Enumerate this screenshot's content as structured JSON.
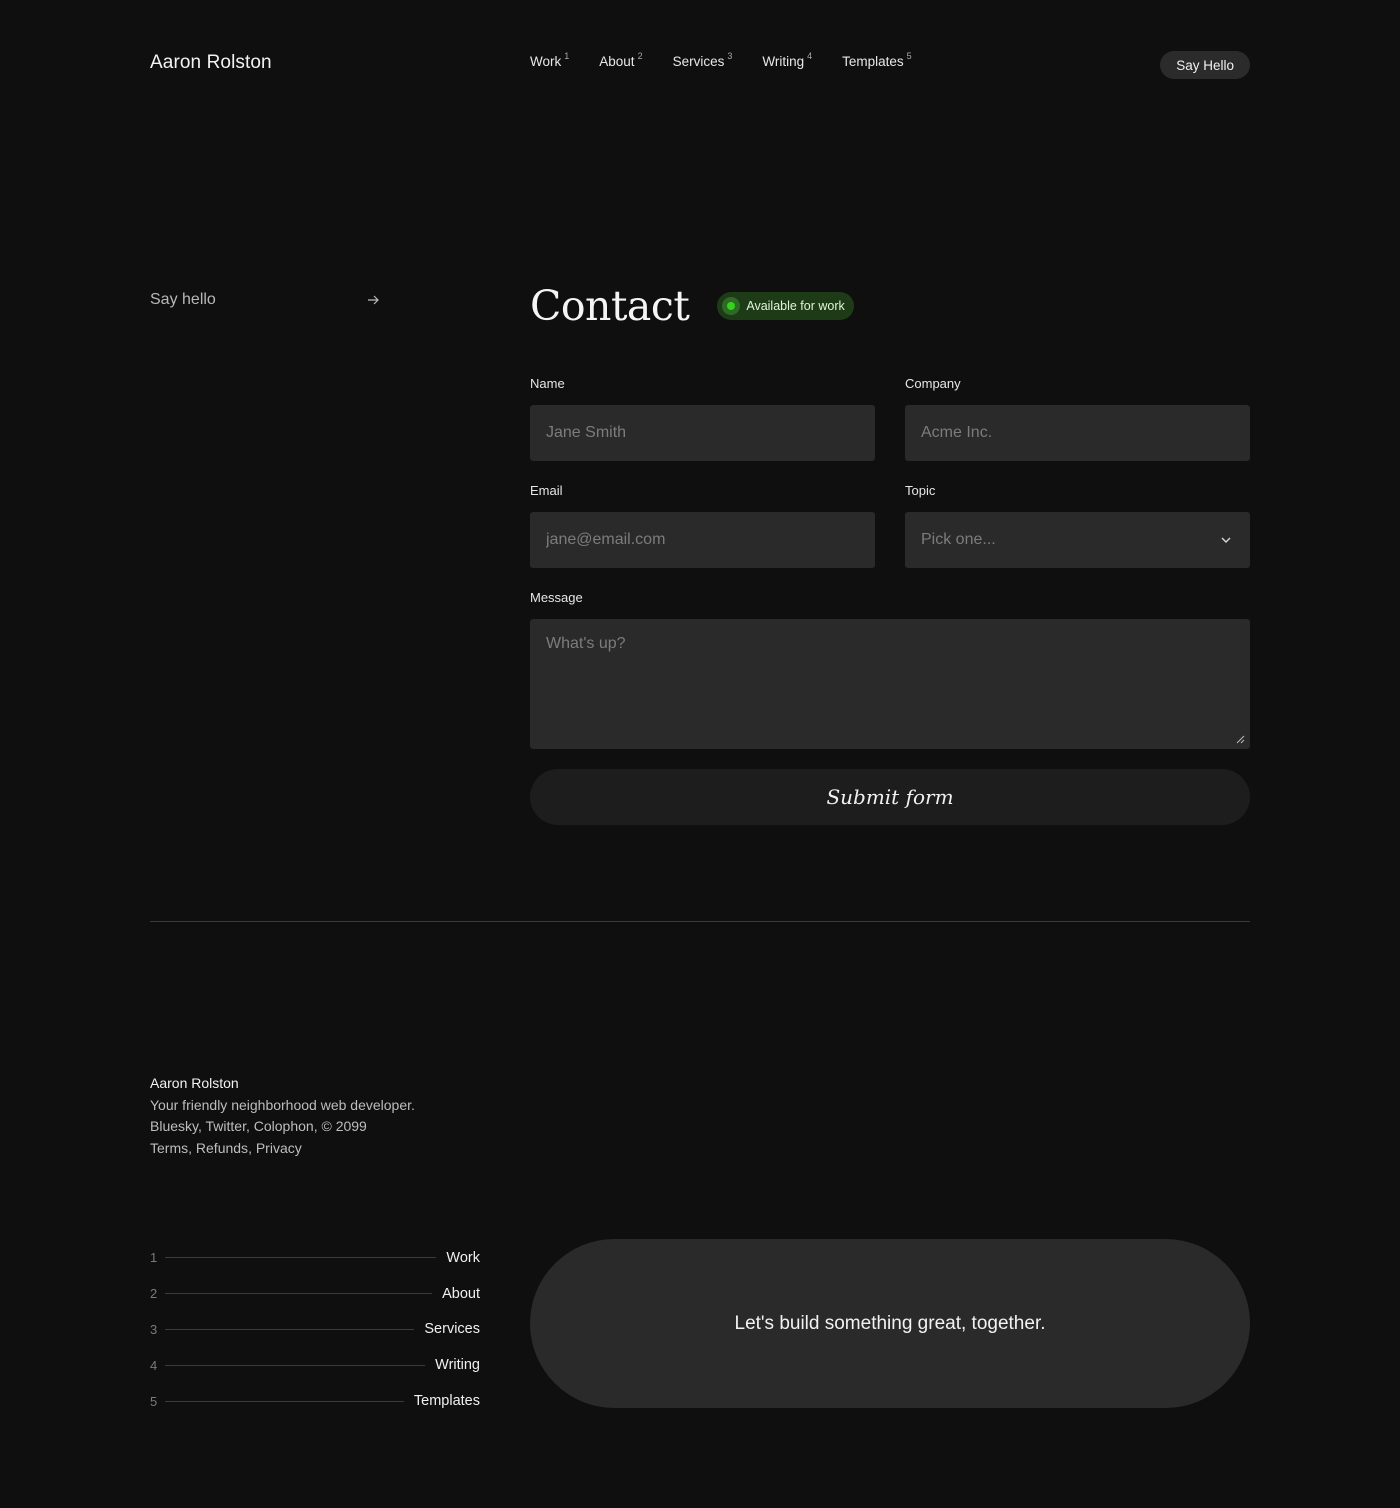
{
  "header": {
    "brand": "Aaron Rolston",
    "nav": [
      {
        "label": "Work",
        "num": "1"
      },
      {
        "label": "About",
        "num": "2"
      },
      {
        "label": "Services",
        "num": "3"
      },
      {
        "label": "Writing",
        "num": "4"
      },
      {
        "label": "Templates",
        "num": "5"
      }
    ],
    "cta_label": "Say Hello"
  },
  "sidebar": {
    "link_label": "Say hello",
    "link_icon": "arrow-right-icon"
  },
  "contact": {
    "title": "Contact",
    "badge": "Available for work",
    "badge_color": "#34d21a",
    "form": {
      "name_label": "Name",
      "name_placeholder": "Jane Smith",
      "company_label": "Company",
      "company_placeholder": "Acme Inc.",
      "email_label": "Email",
      "email_placeholder": "jane@email.com",
      "topic_label": "Topic",
      "topic_value": "Pick one...",
      "message_label": "Message",
      "message_placeholder": "What's up?",
      "submit_label": "Submit form"
    }
  },
  "footer": {
    "name": "Aaron Rolston",
    "tagline": "Your friendly neighborhood web developer.",
    "social": [
      "Bluesky",
      "Twitter",
      "Colophon"
    ],
    "copyright": "© 2099",
    "legal": [
      "Terms",
      "Refunds",
      "Privacy"
    ],
    "nav": [
      {
        "num": "1",
        "label": "Work"
      },
      {
        "num": "2",
        "label": "About"
      },
      {
        "num": "3",
        "label": "Services"
      },
      {
        "num": "4",
        "label": "Writing"
      },
      {
        "num": "5",
        "label": "Templates"
      }
    ],
    "cta": "Let's build something great, together."
  }
}
